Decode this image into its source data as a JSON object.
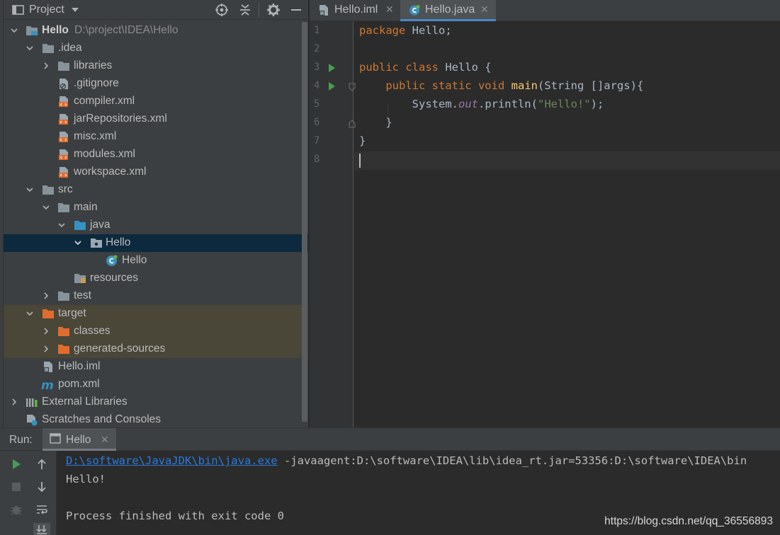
{
  "project_panel": {
    "title": "Project",
    "tree": [
      {
        "label": "Hello",
        "path": "D:\\project\\IDEA\\Hello",
        "icon": "module-folder-icon",
        "expanded": true
      },
      {
        "label": ".idea",
        "icon": "folder-icon",
        "expanded": true
      },
      {
        "label": "libraries",
        "icon": "folder-icon",
        "expanded": false
      },
      {
        "label": ".gitignore",
        "icon": "ignore-file-icon"
      },
      {
        "label": "compiler.xml",
        "icon": "xml-file-icon"
      },
      {
        "label": "jarRepositories.xml",
        "icon": "xml-file-icon"
      },
      {
        "label": "misc.xml",
        "icon": "xml-file-icon"
      },
      {
        "label": "modules.xml",
        "icon": "xml-file-icon"
      },
      {
        "label": "workspace.xml",
        "icon": "xml-file-icon"
      },
      {
        "label": "src",
        "icon": "folder-icon",
        "expanded": true
      },
      {
        "label": "main",
        "icon": "folder-icon",
        "expanded": true
      },
      {
        "label": "java",
        "icon": "source-folder-icon",
        "expanded": true
      },
      {
        "label": "Hello",
        "icon": "package-icon",
        "expanded": true,
        "selected": true
      },
      {
        "label": "Hello",
        "icon": "java-class-icon"
      },
      {
        "label": "resources",
        "icon": "resources-folder-icon"
      },
      {
        "label": "test",
        "icon": "folder-icon",
        "expanded": false
      },
      {
        "label": "target",
        "icon": "excluded-folder-icon",
        "expanded": true
      },
      {
        "label": "classes",
        "icon": "excluded-folder-icon",
        "expanded": false
      },
      {
        "label": "generated-sources",
        "icon": "excluded-folder-icon",
        "expanded": false
      },
      {
        "label": "Hello.iml",
        "icon": "iml-file-icon"
      },
      {
        "label": "pom.xml",
        "icon": "maven-file-icon"
      },
      {
        "label": "External Libraries",
        "icon": "libraries-icon",
        "expanded": false
      },
      {
        "label": "Scratches and Consoles",
        "icon": "scratches-icon"
      }
    ]
  },
  "editor": {
    "tabs": [
      {
        "label": "Hello.iml",
        "active": false
      },
      {
        "label": "Hello.java",
        "active": true
      }
    ],
    "line_numbers": [
      "1",
      "2",
      "3",
      "4",
      "5",
      "6",
      "7",
      "8"
    ],
    "code": {
      "l1_kw": "package",
      "l1_rest": " Hello;",
      "l3_kw": "public class",
      "l3_rest": " Hello {",
      "l4_indent": "    ",
      "l4_kw": "public static void",
      "l4_fn": "main",
      "l4_rest": "(String []args){",
      "l5_a": "        System.",
      "l5_field": "out",
      "l5_b": ".println(",
      "l5_str": "\"Hello!\"",
      "l5_c": ");",
      "l6": "    }",
      "l7": "}"
    }
  },
  "run_panel": {
    "label": "Run:",
    "tab_label": "Hello",
    "console": {
      "link": "D:\\software\\JavaJDK\\bin\\java.exe",
      "cmd_rest": " -javaagent:D:\\software\\IDEA\\lib\\idea_rt.jar=53356:D:\\software\\IDEA\\bin",
      "output": "Hello!",
      "exit": "Process finished with exit code 0"
    }
  },
  "watermark": "https://blog.csdn.net/qq_36556893"
}
